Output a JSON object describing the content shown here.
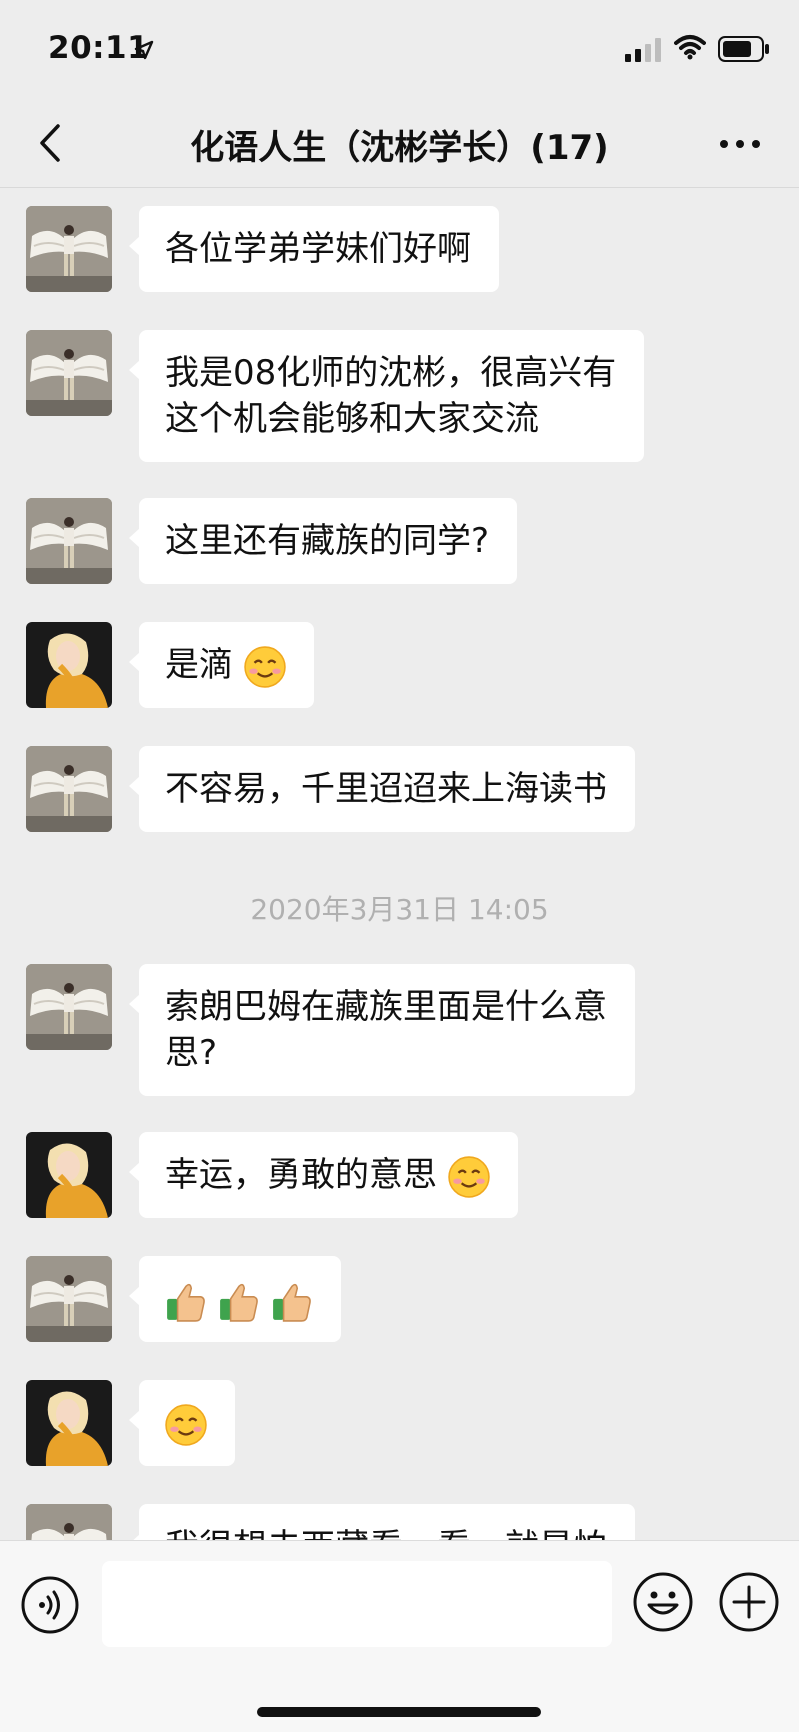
{
  "status_bar": {
    "time": "20:11"
  },
  "nav": {
    "title": "化语人生（沈彬学长）(17)"
  },
  "messages": [
    {
      "sender": "male",
      "text": "各位学弟学妹们好啊"
    },
    {
      "sender": "male",
      "line1": "我是08化师的沈彬，很高兴有",
      "line2": "这个机会能够和大家交流"
    },
    {
      "sender": "male",
      "text": "这里还有藏族的同学?"
    },
    {
      "sender": "female",
      "text": "是滴",
      "emoji": "smile-emoji"
    },
    {
      "sender": "male",
      "text": "不容易，千里迢迢来上海读书"
    },
    {
      "sender": "male",
      "line1": "索朗巴姆在藏族里面是什么意",
      "line2": "思?"
    },
    {
      "sender": "female",
      "text": "幸运，勇敢的意思",
      "emoji": "smile-emoji"
    },
    {
      "sender": "male",
      "emoji": "thumbs-up-emoji x3"
    },
    {
      "sender": "female",
      "emoji": "smile-emoji"
    },
    {
      "sender": "male",
      "text": "我很想去西藏看一看，就是怕"
    }
  ],
  "timestamp": "2020年3月31日 14:05",
  "input": {
    "value": ""
  },
  "colors": {
    "background": "#ededed",
    "bubble": "#ffffff",
    "timestamp": "#b0b0b0"
  }
}
